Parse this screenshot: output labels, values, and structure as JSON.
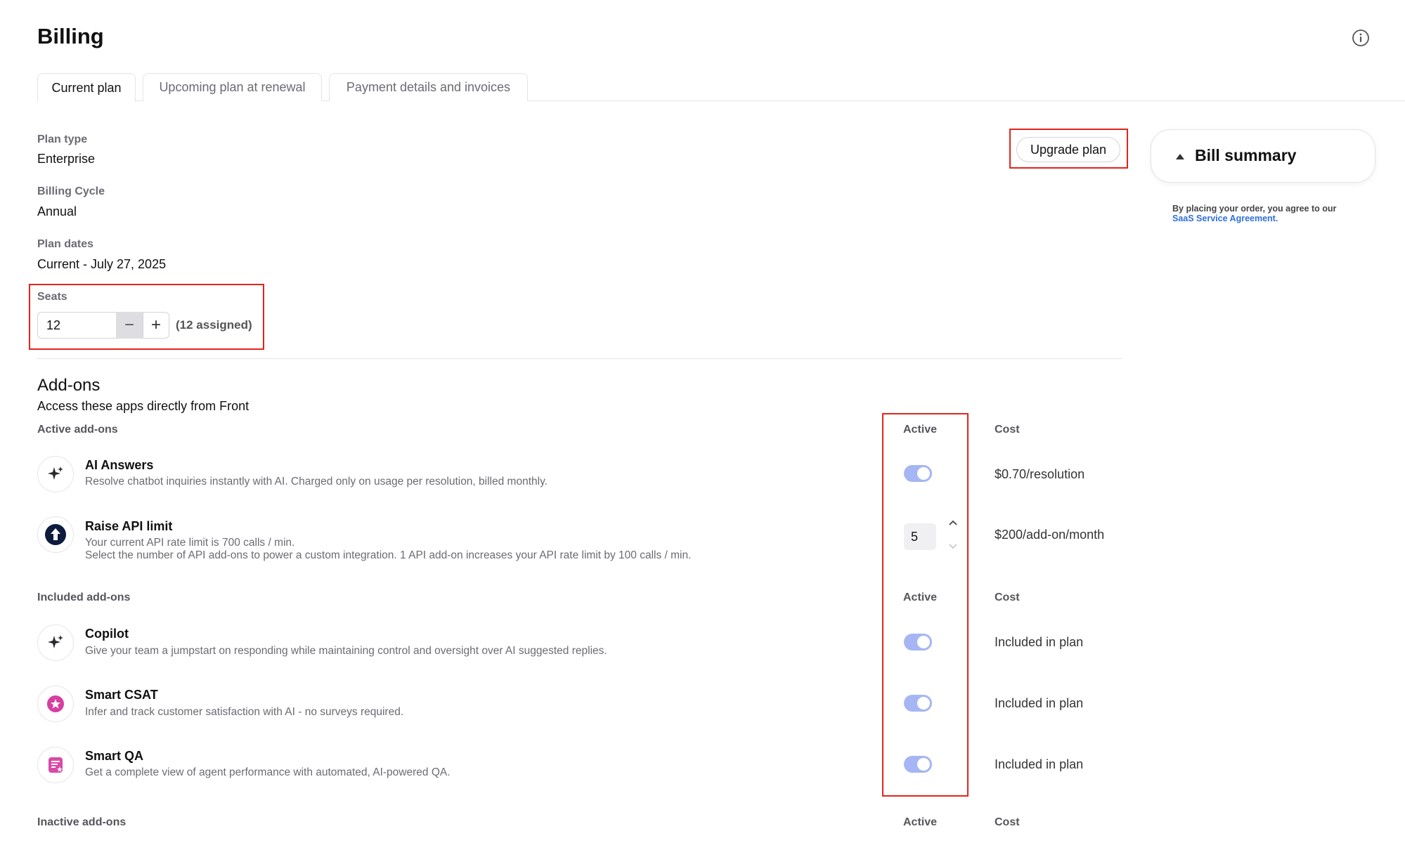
{
  "page": {
    "title": "Billing"
  },
  "tabs": [
    {
      "label": "Current plan",
      "active": true
    },
    {
      "label": "Upcoming plan at renewal",
      "active": false
    },
    {
      "label": "Payment details and invoices",
      "active": false
    }
  ],
  "plan": {
    "type_label": "Plan type",
    "type_value": "Enterprise",
    "cycle_label": "Billing Cycle",
    "cycle_value": "Annual",
    "dates_label": "Plan dates",
    "dates_value": "Current - July 27, 2025",
    "seats_label": "Seats",
    "seats_value": "12",
    "seats_minus": "−",
    "seats_plus": "+",
    "seats_assigned": "(12 assigned)"
  },
  "upgrade": {
    "label": "Upgrade plan"
  },
  "bill_summary": {
    "title": "Bill summary",
    "agreement_text": "By placing your order, you agree to our",
    "agreement_link": "SaaS Service Agreement."
  },
  "addons": {
    "title": "Add-ons",
    "subtitle": "Access these apps directly from Front",
    "active_section": {
      "title": "Active add-ons",
      "col_active": "Active",
      "col_cost": "Cost"
    },
    "included_section": {
      "title": "Included add-ons",
      "col_active": "Active",
      "col_cost": "Cost"
    },
    "inactive_section": {
      "title": "Inactive add-ons",
      "col_active": "Active",
      "col_cost": "Cost"
    },
    "ai_answers": {
      "name": "AI Answers",
      "desc": "Resolve chatbot inquiries instantly with AI. Charged only on usage per resolution, billed monthly.",
      "cost": "$0.70/resolution",
      "icon": "sparkle-icon",
      "active": true
    },
    "raise_api": {
      "name": "Raise API limit",
      "desc1": "Your current API rate limit is 700 calls / min.",
      "desc2": "Select the number of API add-ons to power a custom integration. 1 API add-on increases your API rate limit by 100 calls / min.",
      "quantity": "5",
      "cost": "$200/add-on/month",
      "icon": "arrow-up-circle-icon"
    },
    "copilot": {
      "name": "Copilot",
      "desc": "Give your team a jumpstart on responding while maintaining control and oversight over AI suggested replies.",
      "cost": "Included in plan",
      "icon": "sparkle-icon",
      "active": true
    },
    "smart_csat": {
      "name": "Smart CSAT",
      "desc": "Infer and track customer satisfaction with AI - no surveys required.",
      "cost": "Included in plan",
      "icon": "star-badge-icon",
      "active": true
    },
    "smart_qa": {
      "name": "Smart QA",
      "desc": "Get a complete view of agent performance with automated, AI-powered QA.",
      "cost": "Included in plan",
      "icon": "clipboard-star-icon",
      "active": true
    }
  },
  "colors": {
    "accent_red": "#e1251b",
    "toggle_on": "#a6b5f3",
    "link": "#2f6fdb",
    "csat_pink": "#d63fa0",
    "qa_pink": "#d94aa8"
  }
}
